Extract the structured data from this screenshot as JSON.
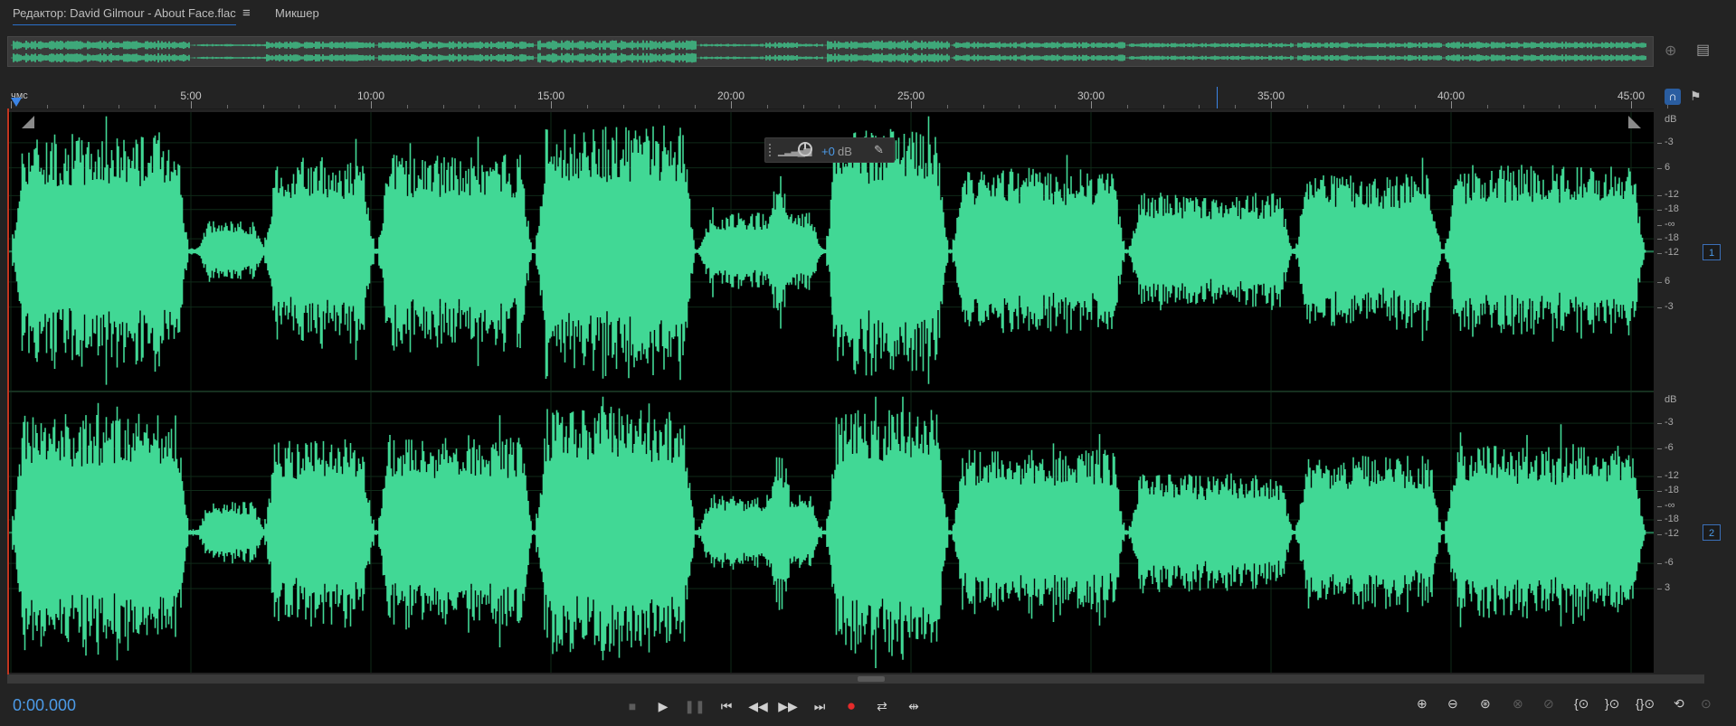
{
  "tabs": {
    "editor_label": "Редактор: David Gilmour - About Face.flac",
    "menu_icon": "hamburger-icon",
    "mixer_label": "Микшер"
  },
  "ruler": {
    "unit_label": "чмс",
    "labels": [
      "5:00",
      "10:00",
      "15:00",
      "20:00",
      "25:00",
      "30:00",
      "35:00",
      "40:00",
      "45:00"
    ]
  },
  "hud": {
    "gain_value": "+0",
    "gain_unit": "dB",
    "pin_icon": "pin-icon"
  },
  "channel_1": {
    "unit": "dB",
    "labels": [
      "-3",
      "6",
      "-12",
      "-18",
      "-∞",
      "-18",
      "-12",
      "6",
      "-3"
    ],
    "badge": "1"
  },
  "channel_2": {
    "unit": "dB",
    "labels": [
      "-3",
      "-6",
      "-12",
      "-18",
      "-∞",
      "-18",
      "-12",
      "-6",
      "3"
    ],
    "badge": "2"
  },
  "transport": {
    "current_time": "0:00.000",
    "buttons": [
      "stop-icon",
      "play-icon",
      "pause-icon",
      "go-to-start-icon",
      "rewind-icon",
      "fast-forward-icon",
      "go-to-end-icon",
      "record-icon",
      "loop-playback-icon",
      "skip-selection-icon"
    ]
  },
  "zoom": {
    "buttons": [
      "zoom-in-amplitude-icon",
      "zoom-out-amplitude-icon",
      "zoom-in-time-icon",
      "zoom-out-full-icon",
      "zoom-selection-icon",
      "zoom-in-left-icon",
      "zoom-in-right-icon",
      "zoom-out-both-icon",
      "reset-zoom-icon",
      "zoom-extra-icon"
    ]
  },
  "colors": {
    "waveform": "#41d895",
    "accent": "#4c9be8",
    "record": "#e52b2b",
    "background": "#232323"
  }
}
